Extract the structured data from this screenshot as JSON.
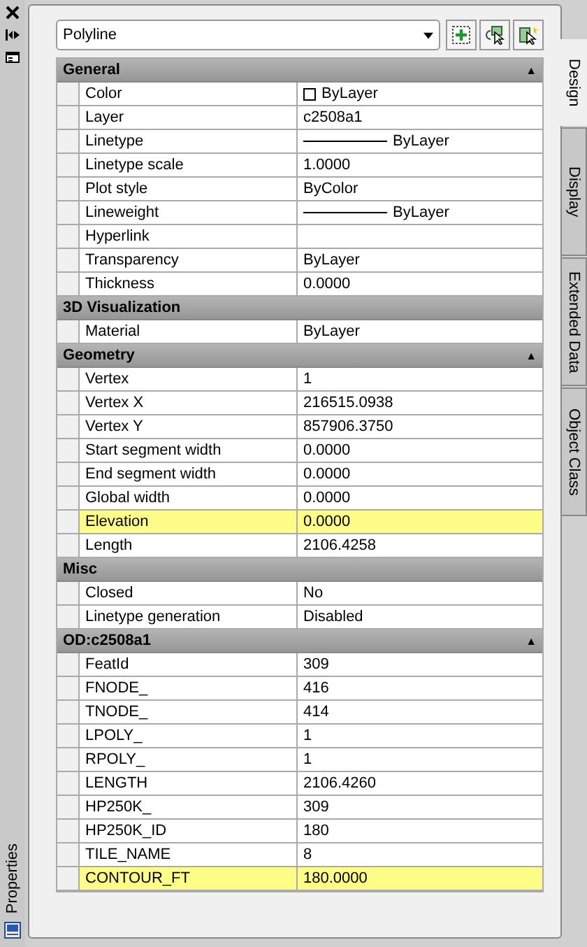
{
  "palette": {
    "title": "Properties"
  },
  "selector": {
    "value": "Polyline"
  },
  "tabs": [
    {
      "label": "Design",
      "selected": true
    },
    {
      "label": "Display",
      "selected": false
    },
    {
      "label": "Extended Data",
      "selected": false
    },
    {
      "label": "Object Class",
      "selected": false
    }
  ],
  "sections": [
    {
      "title": "General",
      "toggle": "▲",
      "rows": [
        {
          "name": "Color",
          "value": "ByLayer",
          "kind": "color",
          "highlighted": false
        },
        {
          "name": "Layer",
          "value": "c2508a1",
          "kind": "text",
          "highlighted": false
        },
        {
          "name": "Linetype",
          "value": "ByLayer",
          "kind": "line",
          "highlighted": false
        },
        {
          "name": "Linetype scale",
          "value": "1.0000",
          "kind": "text",
          "highlighted": false
        },
        {
          "name": "Plot style",
          "value": "ByColor",
          "kind": "text",
          "highlighted": false
        },
        {
          "name": "Lineweight",
          "value": "ByLayer",
          "kind": "line",
          "highlighted": false
        },
        {
          "name": "Hyperlink",
          "kind": "text",
          "highlighted": false
        },
        {
          "name": "Transparency",
          "value": "ByLayer",
          "kind": "text",
          "highlighted": false
        },
        {
          "name": "Thickness",
          "value": "0.0000",
          "kind": "text",
          "highlighted": false
        }
      ]
    },
    {
      "title": "3D Visualization",
      "rows": [
        {
          "name": "Material",
          "value": "ByLayer",
          "kind": "text",
          "highlighted": false
        }
      ]
    },
    {
      "title": "Geometry",
      "toggle": "▲",
      "rows": [
        {
          "name": "Vertex",
          "value": "1",
          "kind": "text",
          "highlighted": false
        },
        {
          "name": "Vertex X",
          "value": "216515.0938",
          "kind": "text",
          "highlighted": false
        },
        {
          "name": "Vertex Y",
          "value": "857906.3750",
          "kind": "text",
          "highlighted": false
        },
        {
          "name": "Start segment width",
          "value": "0.0000",
          "kind": "text",
          "highlighted": false
        },
        {
          "name": "End segment width",
          "value": "0.0000",
          "kind": "text",
          "highlighted": false
        },
        {
          "name": "Global width",
          "value": "0.0000",
          "kind": "text",
          "highlighted": false
        },
        {
          "name": "Elevation",
          "value": "0.0000",
          "kind": "text",
          "highlighted": true
        },
        {
          "name": "Length",
          "value": "2106.4258",
          "kind": "text",
          "highlighted": false
        }
      ]
    },
    {
      "title": "Misc",
      "rows": [
        {
          "name": "Closed",
          "value": "No",
          "kind": "text",
          "highlighted": false
        },
        {
          "name": "Linetype generation",
          "value": "Disabled",
          "kind": "text",
          "highlighted": false
        }
      ]
    },
    {
      "title": "OD:c2508a1",
      "toggle": "▲",
      "rows": [
        {
          "name": "FeatId",
          "value": "309",
          "kind": "text",
          "highlighted": false
        },
        {
          "name": "FNODE_",
          "value": "416",
          "kind": "text",
          "highlighted": false
        },
        {
          "name": "TNODE_",
          "value": "414",
          "kind": "text",
          "highlighted": false
        },
        {
          "name": "LPOLY_",
          "value": "1",
          "kind": "text",
          "highlighted": false
        },
        {
          "name": "RPOLY_",
          "value": "1",
          "kind": "text",
          "highlighted": false
        },
        {
          "name": "LENGTH",
          "value": "2106.4260",
          "kind": "text",
          "highlighted": false
        },
        {
          "name": "HP250K_",
          "value": "309",
          "kind": "text",
          "highlighted": false
        },
        {
          "name": "HP250K_ID",
          "value": "180",
          "kind": "text",
          "highlighted": false
        },
        {
          "name": "TILE_NAME",
          "value": "8",
          "kind": "text",
          "highlighted": false
        },
        {
          "name": "CONTOUR_FT",
          "value": "180.0000",
          "kind": "text",
          "highlighted": true
        }
      ]
    }
  ]
}
